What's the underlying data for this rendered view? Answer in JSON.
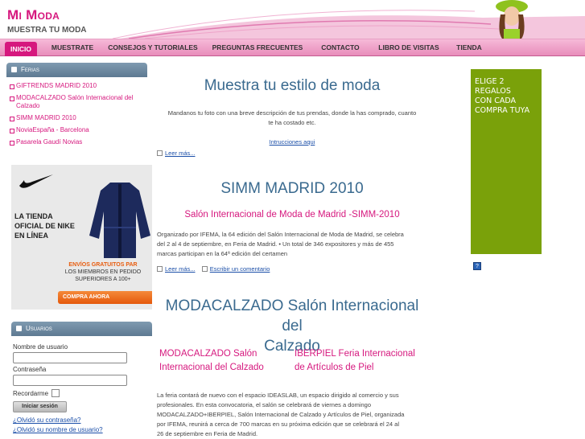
{
  "header": {
    "site_title": "Mi Moda",
    "tagline": "MUESTRA TU MODA"
  },
  "nav": {
    "items": [
      {
        "label": "INICIO",
        "active": true
      },
      {
        "label": "MUESTRATE"
      },
      {
        "label": "CONSEJOS Y TUTORIALES"
      },
      {
        "label": "PREGUNTAS FRECUENTES"
      },
      {
        "label": "CONTACTO"
      },
      {
        "label": "LIBRO DE VISITAS"
      },
      {
        "label": "TIENDA"
      }
    ]
  },
  "sidebar": {
    "ferias_title": "Ferias",
    "ferias": [
      "GIFTRENDS MADRID 2010",
      "MODACALZADO Salón Internacional del Calzado",
      "SIMM MADRID 2010",
      "NoviaEspaña - Barcelona",
      "Pasarela Gaudí Novias"
    ],
    "ad": {
      "line1": "LA TIENDA",
      "line2": "OFICIAL DE NIKE",
      "line3": "EN LÍNEA",
      "envios": "ENVÍOS GRATUITOS PAR",
      "members1": "LOS MIEMBROS EN PEDIDO",
      "members2": "SUPERIORES A 100+",
      "button": "COMPRA AHORA"
    },
    "usuarios_title": "Usuarios",
    "login": {
      "username_label": "Nombre de usuario",
      "password_label": "Contraseña",
      "remember_label": "Recordarme",
      "button": "Iniciar sesión",
      "forgot_password": "¿Olvidó su contraseña?",
      "forgot_username": "¿Olvidó su nombre de usuario?"
    }
  },
  "main": {
    "post1": {
      "title": "Muestra tu estilo de moda",
      "body1": "Mandanos tu foto con una breve descripción de tus prendas, donde la has comprado, cuanto",
      "body2": "te ha costado etc.",
      "link": "Intrucciones aqui",
      "more": "Leer más..."
    },
    "post2": {
      "title": "SIMM MADRID 2010",
      "subtitle": "Salón Internacional de Moda de Madrid -SIMM-2010",
      "body1": "Organizado por IFEMA, la 64 edición del Salón Internacional de Moda de Madrid, se celebra",
      "body2": "del 2 al 4 de septiembre, en Feria de Madrid. • Un total de 346 expositores y más de 455",
      "body3": "marcas participan en la 64ª edición del certamen",
      "more": "Leer más...",
      "comment": "Escribir un comentario"
    },
    "post3": {
      "title1": "MODACALZADO Salón Internacional del",
      "title2": "Calzado",
      "col1_1": "MODACALZADO Salón",
      "col1_2": "Internacional del Calzado",
      "col2_1": "IBERPIEL Feria Internacional",
      "col2_2": "de Artículos de Piel",
      "body1": "La feria contará de nuevo con el espacio IDEASLAB, un espacio dirigido al comercio y sus",
      "body2": "profesionales. En esta convocatoria, el salón se celebrará de viernes a domingo",
      "body3": "MODACALZADO+IBERPIEL, Salón Internacional de Calzado y Artículos de Piel, organizada",
      "body4": "por IFEMA, reunirá a cerca de 700 marcas en su próxima edición que se celebrará el 24 al",
      "body5": "26 de septiembre en Feria de Madrid."
    }
  },
  "right": {
    "promo1": "ELIGE 2 REGALOS",
    "promo2": "CON CADA",
    "promo3": "COMPRA TUYA",
    "help": "?"
  },
  "colors": {
    "brand": "#d6187e",
    "nav": "#e88dbb",
    "promo": "#7aa10a"
  }
}
